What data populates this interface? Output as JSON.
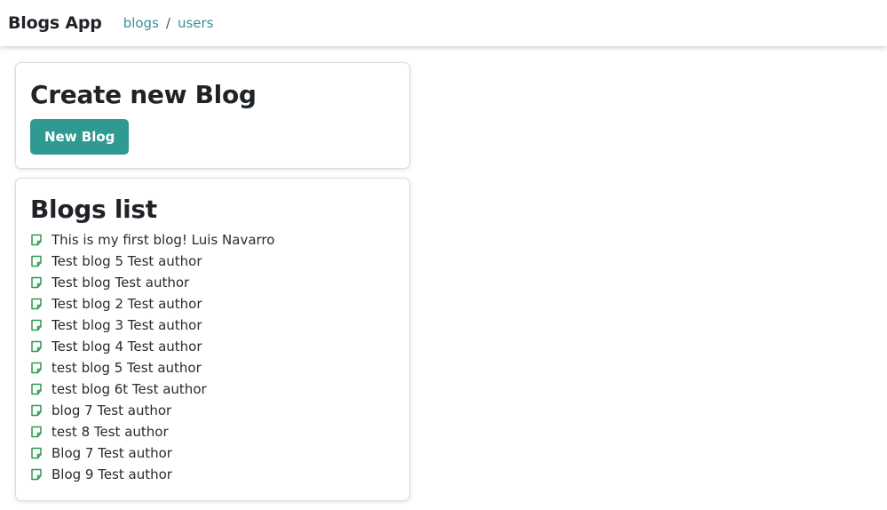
{
  "navbar": {
    "brand": "Blogs App",
    "links": [
      {
        "label": "blogs"
      },
      {
        "label": "users"
      }
    ],
    "separator": "/"
  },
  "create_card": {
    "title": "Create new Blog",
    "button_label": "New Blog"
  },
  "list_card": {
    "title": "Blogs list",
    "icon": "sticky-note-icon",
    "items": [
      {
        "text": "This is my first blog! Luis Navarro"
      },
      {
        "text": "Test blog 5 Test author"
      },
      {
        "text": "Test blog Test author"
      },
      {
        "text": "Test blog 2 Test author"
      },
      {
        "text": "Test blog 3 Test author"
      },
      {
        "text": "Test blog 4 Test author"
      },
      {
        "text": "test blog 5 Test author"
      },
      {
        "text": "test blog 6t Test author"
      },
      {
        "text": "blog 7 Test author"
      },
      {
        "text": "test 8 Test author"
      },
      {
        "text": "Blog 7 Test author"
      },
      {
        "text": "Blog 9 Test author"
      }
    ]
  },
  "colors": {
    "accent": "#2f9a92",
    "link": "#3a8f9a",
    "icon": "#2e9a52"
  }
}
